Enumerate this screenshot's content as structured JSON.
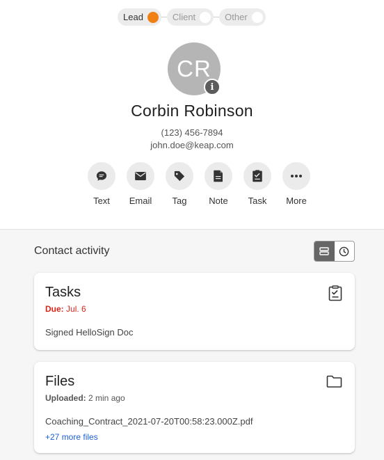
{
  "stages": [
    {
      "label": "Lead",
      "active": true
    },
    {
      "label": "Client",
      "active": false
    },
    {
      "label": "Other",
      "active": false
    }
  ],
  "contact": {
    "initials": "CR",
    "name": "Corbin Robinson",
    "phone": "(123) 456-7894",
    "email": "john.doe@keap.com"
  },
  "actions": [
    {
      "label": "Text",
      "icon": "message-icon"
    },
    {
      "label": "Email",
      "icon": "mail-icon"
    },
    {
      "label": "Tag",
      "icon": "tag-icon"
    },
    {
      "label": "Note",
      "icon": "note-icon"
    },
    {
      "label": "Task",
      "icon": "task-icon"
    },
    {
      "label": "More",
      "icon": "more-icon"
    }
  ],
  "activity": {
    "title": "Contact activity"
  },
  "tasks_card": {
    "title": "Tasks",
    "due_label": "Due:",
    "due_date": "Jul. 6",
    "item": "Signed HelloSign Doc"
  },
  "files_card": {
    "title": "Files",
    "uploaded_label": "Uploaded:",
    "uploaded_time": "2 min ago",
    "file_name": "Coaching_Contract_2021-07-20T00:58:23.000Z.pdf",
    "more_files": "+27 more files"
  },
  "colors": {
    "accent": "#f07f14",
    "due": "#d7261c",
    "link": "#1f5fd6"
  }
}
